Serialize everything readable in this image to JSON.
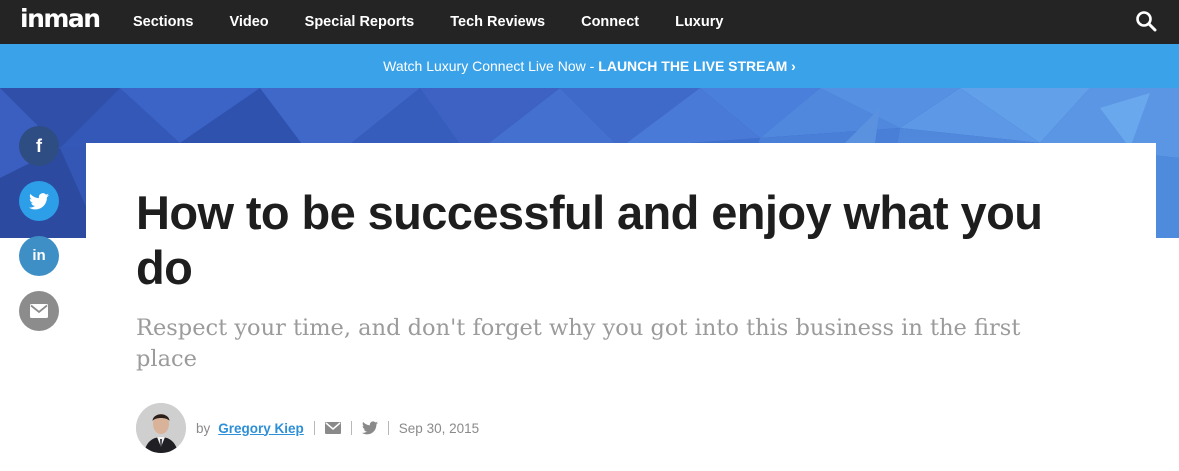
{
  "brand": {
    "logo_text": "inman"
  },
  "nav": {
    "items": [
      {
        "label": "Sections"
      },
      {
        "label": "Video"
      },
      {
        "label": "Special Reports"
      },
      {
        "label": "Tech Reviews"
      },
      {
        "label": "Connect"
      },
      {
        "label": "Luxury"
      }
    ],
    "search_icon": "search-icon"
  },
  "promo": {
    "text": "Watch Luxury Connect Live Now -",
    "link_label": "LAUNCH THE LIVE STREAM ›"
  },
  "share": {
    "facebook_glyph": "f",
    "linkedin_glyph": "in",
    "icons": [
      "facebook-icon",
      "twitter-icon",
      "linkedin-icon",
      "email-icon"
    ]
  },
  "article": {
    "headline": "How to be successful and enjoy what you do",
    "subheadline": "Respect your time, and don't forget why you got into this business in the first place",
    "byline": {
      "by": "by",
      "author": "Gregory Kiep",
      "date": "Sep 30, 2015"
    }
  },
  "colors": {
    "nav_bg": "#242424",
    "promo_bg": "#3aa2e9",
    "hero_bg": "#3458b7",
    "link": "#2d8fd6"
  }
}
